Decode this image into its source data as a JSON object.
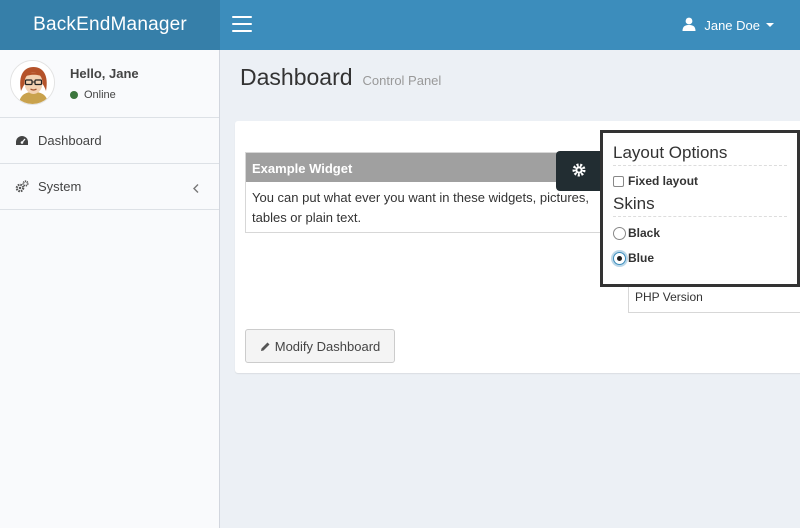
{
  "brand": {
    "title": "BackEndManager"
  },
  "header": {
    "user_name": "Jane Doe"
  },
  "sidebar": {
    "greeting": "Hello, Jane",
    "status": "Online",
    "items": [
      {
        "label": "Dashboard",
        "icon": "dashboard-icon"
      },
      {
        "label": "System",
        "icon": "cogs-icon"
      }
    ]
  },
  "content": {
    "title": "Dashboard",
    "subtitle": "Control Panel",
    "widget": {
      "title": "Example Widget",
      "body": "You can put what ever you want in these widgets, pictures, tables or plain text."
    },
    "widget2": {
      "text": "PHP Version"
    },
    "modify_button": "Modify Dashboard"
  },
  "layout_options": {
    "title": "Layout Options",
    "fixed_layout": "Fixed layout",
    "skins_title": "Skins",
    "skins": [
      "Black",
      "Blue"
    ],
    "selected_skin": "Blue"
  },
  "colors": {
    "brand": "#367fa9",
    "navbar": "#3c8dbc",
    "sidebar": "#f9fafc",
    "control_tab": "#222d32"
  }
}
